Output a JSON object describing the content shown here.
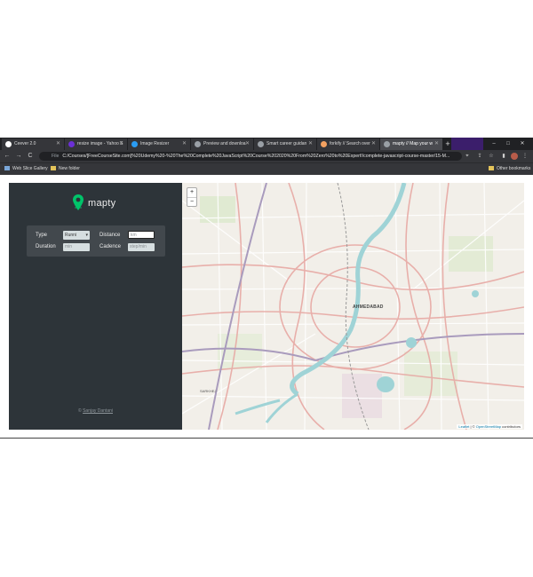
{
  "browser": {
    "tabs": [
      {
        "title": "Ceever 2.0",
        "favicon_color": "#ffffff"
      },
      {
        "title": "resize image - Yahoo S",
        "favicon_color": "#6b2fd6"
      },
      {
        "title": "Image Resizer",
        "favicon_color": "#2a9df4"
      },
      {
        "title": "Preview and downloa",
        "favicon_color": "#9aa0a6"
      },
      {
        "title": "Smart career guidan",
        "favicon_color": "#9aa0a6"
      },
      {
        "title": "forkify // Search over",
        "favicon_color": "#f4a261"
      },
      {
        "title": "mapty // Map your w",
        "favicon_color": "#9aa0a6",
        "active": true
      }
    ],
    "new_tab_label": "+",
    "window_controls": {
      "minimize": "–",
      "maximize": "□",
      "close": "✕"
    },
    "nav": {
      "back": "←",
      "forward": "→",
      "reload": "C"
    },
    "address": {
      "scheme_label": "File",
      "url": "C:/Courses/[FreeCourseSite.com]%20Udemy%20-%20The%20Complete%20JavaScript%20Course%202020%20From%20Zero%20to%20Expert!/complete-javascript-course-master/15-M..."
    },
    "bookmarks": [
      {
        "label": "Web Slice Gallery",
        "icon": "web-slice-icon"
      },
      {
        "label": "New folder",
        "icon": "folder-icon"
      }
    ],
    "other_bookmarks_label": "Other bookmarks"
  },
  "app": {
    "brand": "mapty",
    "brand_color": "#00c46a",
    "form": {
      "type_label": "Type",
      "type_value": "Runni",
      "distance_label": "Distance",
      "distance_placeholder": "km",
      "duration_label": "Duration",
      "duration_placeholder": "min",
      "cadence_label": "Cadence",
      "cadence_placeholder": "step/min"
    },
    "copyright_prefix": "©",
    "copyright_author": "Sanjay Dantani"
  },
  "map": {
    "zoom_in": "+",
    "zoom_out": "−",
    "city_label": "AHMEDABAD",
    "area_label": "SARKHEJ",
    "attribution_leaflet": "Leaflet",
    "attribution_sep": " | © ",
    "attribution_osm": "OpenStreetMap",
    "attribution_suffix": " contributors"
  }
}
